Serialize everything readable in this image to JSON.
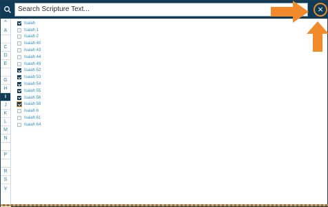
{
  "search": {
    "placeholder": "Search Scripture Text..."
  },
  "close": {
    "label": "×"
  },
  "sidebar": {
    "up": "^",
    "down": "v",
    "letters": [
      "A",
      "",
      "C",
      "D",
      "E",
      "",
      "G",
      "H",
      "I",
      "J",
      "K",
      "L",
      "M",
      "N",
      "",
      "P",
      "",
      "R",
      "S"
    ],
    "active": "I"
  },
  "list": {
    "items": [
      {
        "label": "Isaiah",
        "checked": true
      },
      {
        "label": "Isaiah 1",
        "checked": false
      },
      {
        "label": "Isaiah 2",
        "checked": false
      },
      {
        "label": "Isaiah 40",
        "checked": false
      },
      {
        "label": "Isaiah 43",
        "checked": false
      },
      {
        "label": "Isaiah 44",
        "checked": false
      },
      {
        "label": "Isaiah 49",
        "checked": false
      },
      {
        "label": "Isaiah 52",
        "checked": true
      },
      {
        "label": "Isaiah 53",
        "checked": true
      },
      {
        "label": "Isaiah 54",
        "checked": true
      },
      {
        "label": "Isaiah 55",
        "checked": true
      },
      {
        "label": "Isaiah 56",
        "checked": true
      },
      {
        "label": "Isaiah 58",
        "checked": true
      },
      {
        "label": "Isaiah 6",
        "checked": false
      },
      {
        "label": "Isaiah 61",
        "checked": false
      },
      {
        "label": "Isaiah 64",
        "checked": false
      }
    ]
  },
  "colors": {
    "navy": "#0f3b57",
    "accent": "#f08a2b",
    "link": "#2f8fc4"
  }
}
